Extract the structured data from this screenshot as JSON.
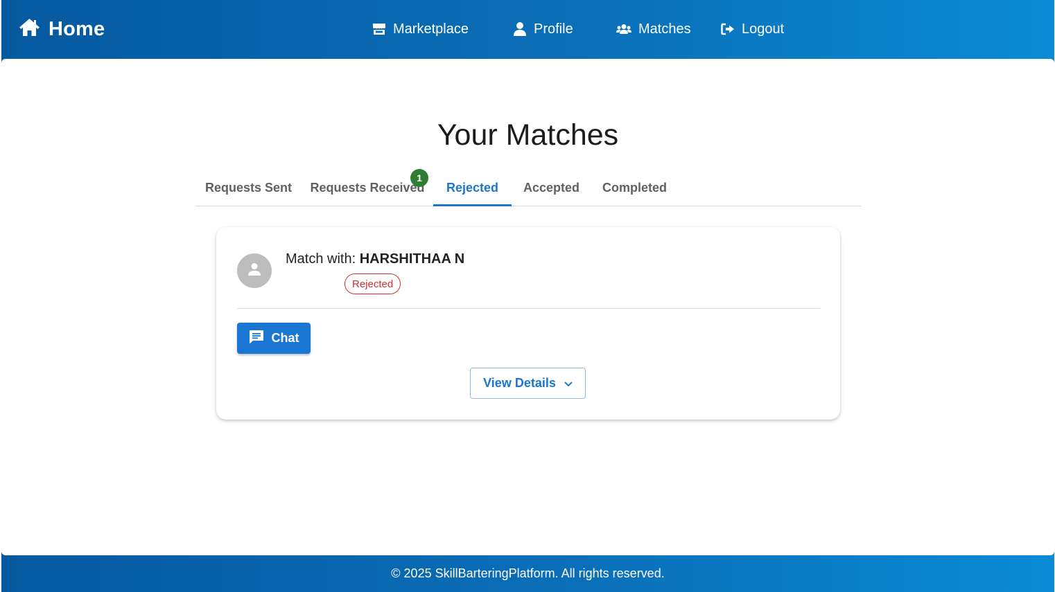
{
  "header": {
    "home_label": "Home",
    "home_icon": "home-icon",
    "nav": [
      {
        "label": "Marketplace",
        "icon": "store-icon"
      },
      {
        "label": "Profile",
        "icon": "person-icon"
      },
      {
        "label": "Matches",
        "icon": "users-icon"
      },
      {
        "label": "Logout",
        "icon": "logout-icon"
      }
    ]
  },
  "main": {
    "title": "Your Matches",
    "tabs": [
      {
        "label": "Requests Sent",
        "active": false
      },
      {
        "label": "Requests Received",
        "active": false,
        "badge": "1"
      },
      {
        "label": "Rejected",
        "active": true
      },
      {
        "label": "Accepted",
        "active": false
      },
      {
        "label": "Completed",
        "active": false
      }
    ],
    "card": {
      "match_prefix": "Match with:",
      "match_name": "HARSHITHAA N",
      "status": "Rejected",
      "chat_label": "Chat",
      "details_label": "View Details"
    }
  },
  "footer": {
    "text": "© 2025 SkillBarteringPlatform. All rights reserved."
  },
  "colors": {
    "primary": "#1976d2",
    "header_gradient_start": "#0559a0",
    "header_gradient_end": "#0a8ad6",
    "badge": "#2e7d32",
    "rejected": "#d32f2f"
  }
}
